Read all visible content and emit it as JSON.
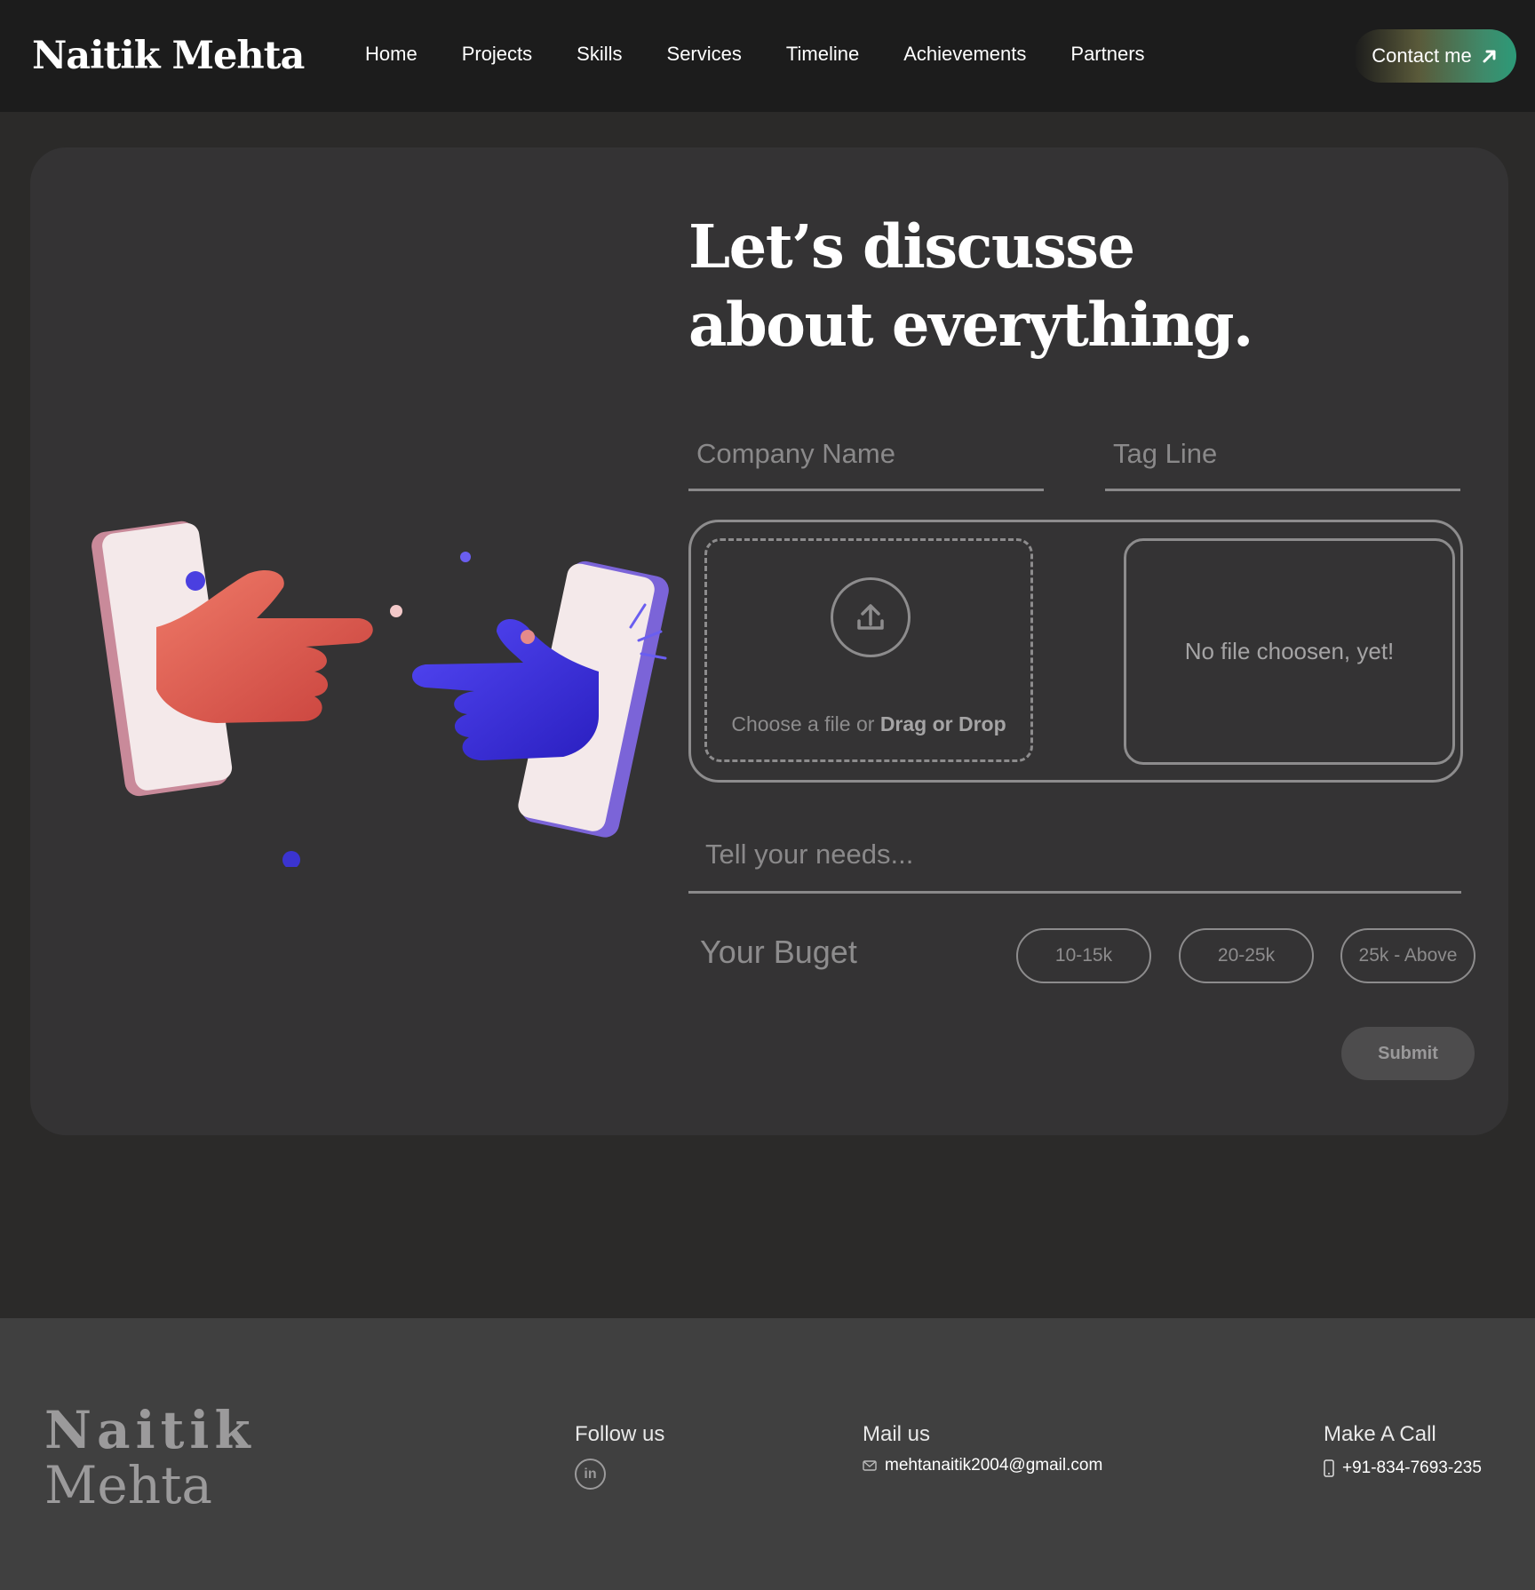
{
  "nav": {
    "brand": "Naitik Mehta",
    "items": [
      "Home",
      "Projects",
      "Skills",
      "Services",
      "Timeline",
      "Achievements",
      "Partners"
    ],
    "contact_label": "Contact me"
  },
  "hero": {
    "headline_line1": "Let’s discusse",
    "headline_line2": "about everything."
  },
  "form": {
    "company_placeholder": "Company Name",
    "tagline_placeholder": "Tag Line",
    "upload_text": "Choose a file or",
    "upload_bold": "Drag or Drop",
    "file_status": "No file choosen,  yet!",
    "needs_placeholder": "Tell your needs...",
    "budget_label": "Your Buget",
    "budget_options": [
      "10-15k",
      "20-25k",
      "25k - Above"
    ],
    "submit_label": "Submit"
  },
  "footer": {
    "brand_line1": "Naitik",
    "brand_line2": "Mehta",
    "follow_title": "Follow us",
    "linkedin_label": "in",
    "mail_title": "Mail us",
    "email": "mehtanaitik2004@gmail.com",
    "call_title": "Make A Call",
    "phone": "+91-834-7693-235"
  },
  "colors": {
    "nav_bg": "#1c1c1c",
    "page_bg": "#2b2a29",
    "card_bg": "#343334",
    "footer_bg": "#404040",
    "accent_green": "#2c9a78",
    "hand_red": "#e0584e",
    "hand_blue": "#3b2de0"
  }
}
